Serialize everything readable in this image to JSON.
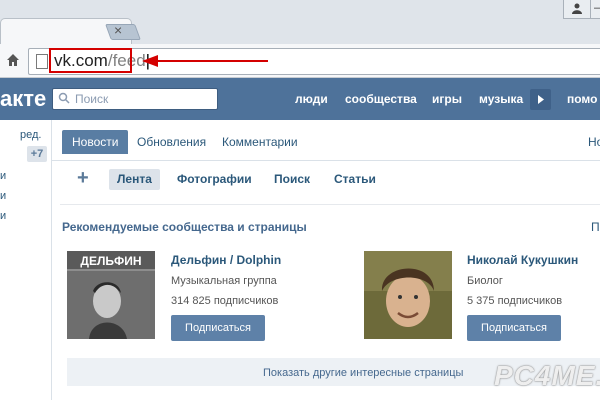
{
  "browser": {
    "tab_close": "×",
    "win_button_icon": "person-icon",
    "url_host": "vk.com",
    "url_path": "/feed"
  },
  "vk": {
    "logo": "акте",
    "search_placeholder": "Поиск",
    "nav": [
      "люди",
      "сообщества",
      "игры",
      "музыка",
      "помо"
    ]
  },
  "sidebar": {
    "edit": "ред.",
    "count": "+7",
    "items": [
      "и",
      "и",
      "и"
    ]
  },
  "feed_tabs": [
    "Новости",
    "Обновления",
    "Комментарии"
  ],
  "feed_tab_edge": "Но",
  "sub_filters": [
    "Лента",
    "Фотографии",
    "Поиск",
    "Статьи"
  ],
  "recommended": {
    "title": "Рекомендуемые сообщества и страницы",
    "edge": "П",
    "cards": [
      {
        "name": "Дельфин / Dolphin",
        "type": "Музыкальная группа",
        "subs": "314 825 подписчиков",
        "button": "Подписаться",
        "image_text": "ДЕЛЬФИН"
      },
      {
        "name": "Николай Кукушкин",
        "type": "Биолог",
        "subs": "5 375 подписчиков",
        "button": "Подписаться"
      }
    ],
    "more": "Показать другие интересные страницы"
  },
  "watermark": "PC4ME.I",
  "colors": {
    "vk_blue": "#4e729a",
    "accent_red": "#d40000",
    "button": "#5e81a8"
  }
}
